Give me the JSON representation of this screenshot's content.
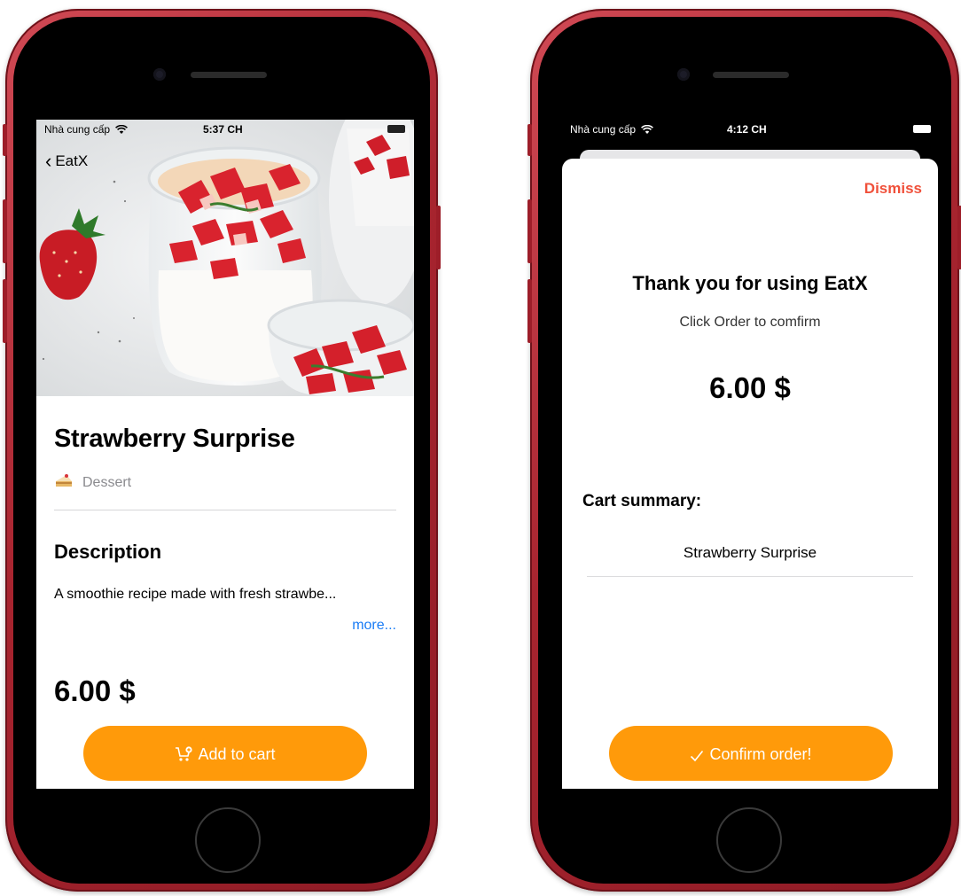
{
  "left_phone": {
    "status": {
      "carrier": "Nhà cung cấp",
      "time": "5:37 CH"
    },
    "nav": {
      "back_label": "EatX"
    },
    "food": {
      "title": "Strawberry Surprise",
      "category": "Dessert",
      "description_title": "Description",
      "description_text": "A smoothie recipe made with fresh strawbe...",
      "more_label": "more...",
      "price": "6.00 $"
    },
    "cta_label": "Add to cart",
    "icons": {
      "back": "chevron-left-icon",
      "wifi": "wifi-icon",
      "category": "cake-icon",
      "cart": "cart-add-icon"
    }
  },
  "right_phone": {
    "status": {
      "carrier": "Nhà cung cấp",
      "time": "4:12 CH"
    },
    "dismiss_label": "Dismiss",
    "thanks_text": "Thank you for using EatX",
    "subtext": "Click Order to comfirm",
    "price": "6.00 $",
    "cart_summary_title": "Cart summary:",
    "cart_items": [
      "Strawberry Surprise"
    ],
    "cta_label": "Confirm order!",
    "icons": {
      "wifi": "wifi-icon",
      "confirm": "checkmark-icon",
      "battery": "battery-icon"
    }
  },
  "colors": {
    "accent_orange": "#ff9a0a",
    "dismiss_red": "#f0503a",
    "link_blue": "#1a7cf5",
    "phone_red": "#a8242f"
  }
}
